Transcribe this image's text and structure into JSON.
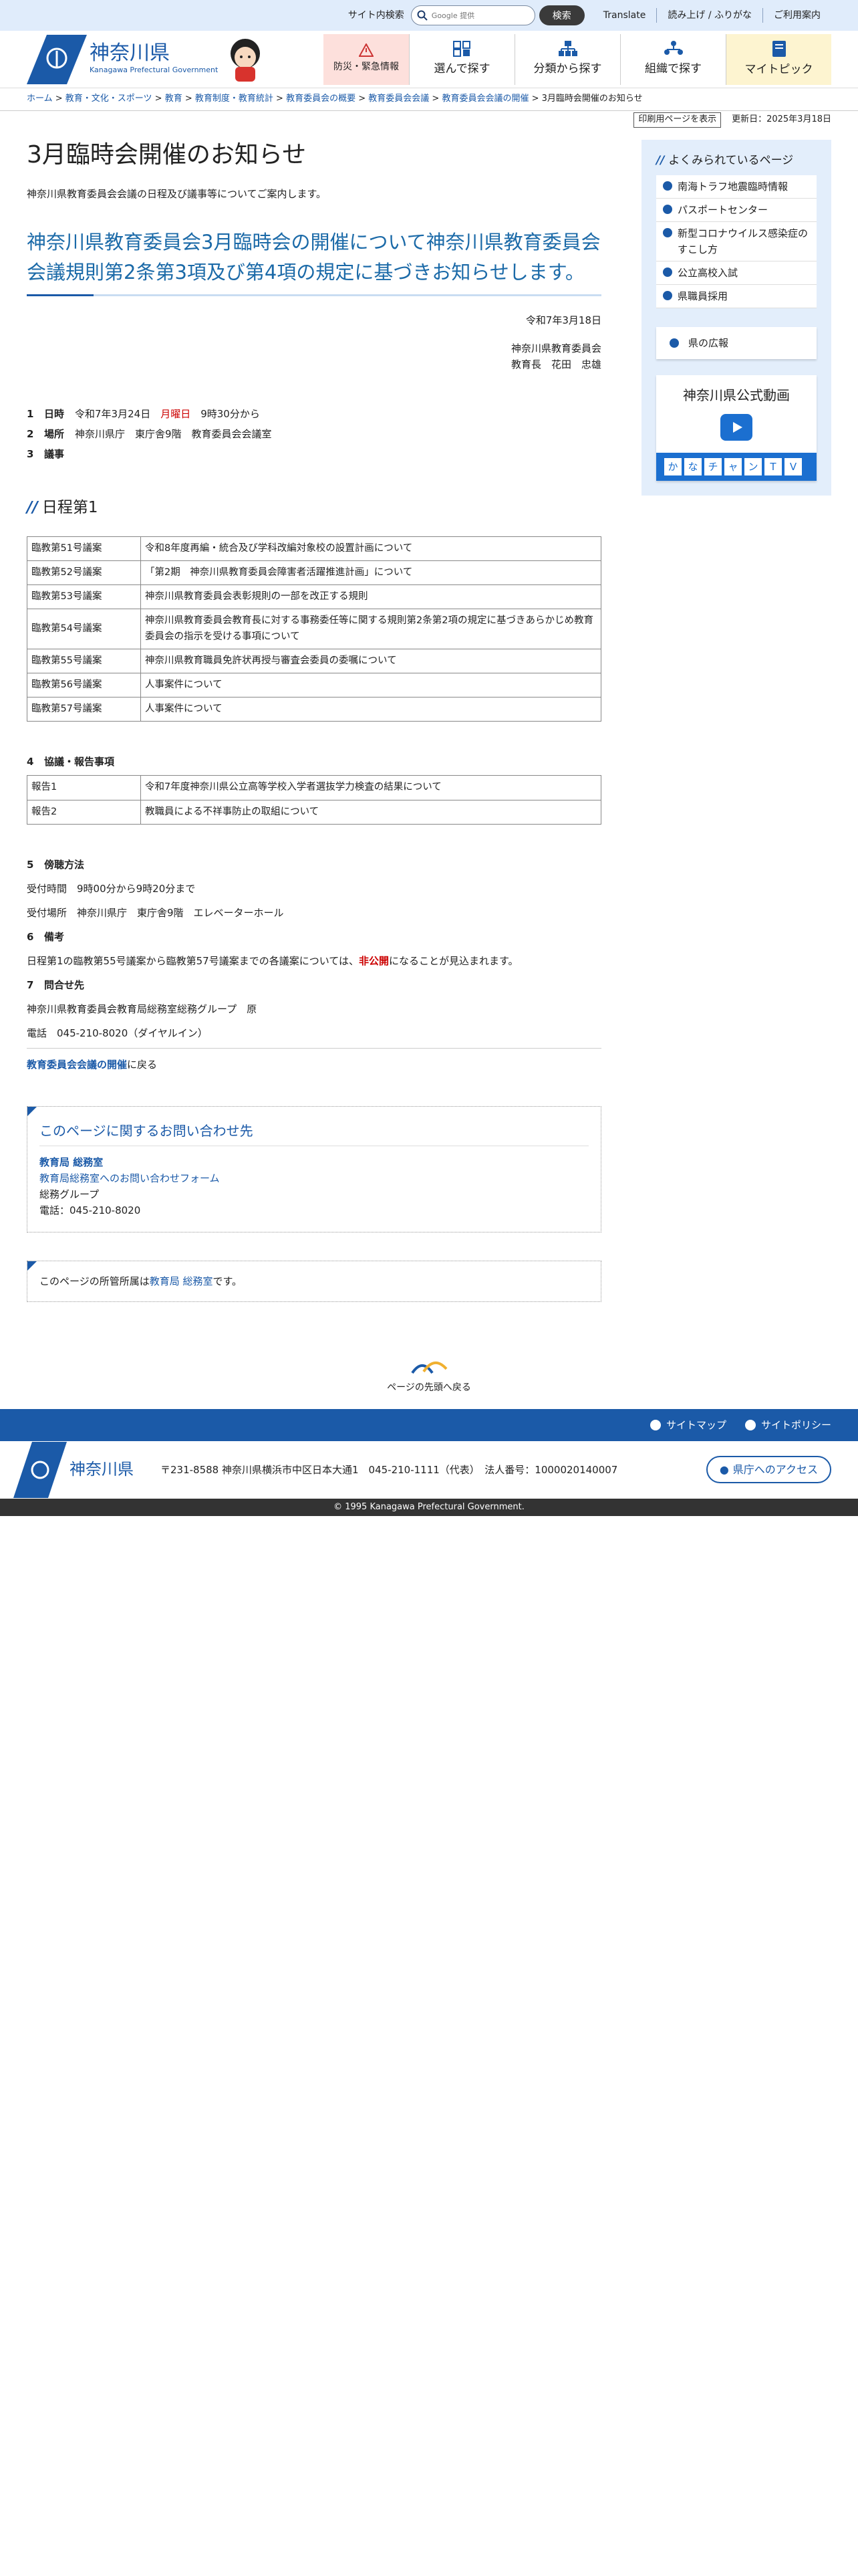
{
  "topbar": {
    "search_label": "サイト内検索",
    "search_placeholder": "Google 提供",
    "search_button": "検索",
    "links": [
      "Translate",
      "読み上げ / ふりがな",
      "ご利用案内"
    ]
  },
  "header": {
    "logo_jp": "神奈川県",
    "logo_en": "Kanagawa Prefectural Government",
    "nav": [
      "防災・緊急情報",
      "選んで探す",
      "分類から探す",
      "組織で探す",
      "マイトピック"
    ]
  },
  "breadcrumb": [
    "ホーム",
    "教育・文化・スポーツ",
    "教育",
    "教育制度・教育統計",
    "教育委員会の概要",
    "教育委員会会議",
    "教育委員会会議の開催",
    "3月臨時会開催のお知らせ"
  ],
  "print_button": "印刷用ページを表示",
  "updated": "更新日：2025年3月18日",
  "main": {
    "title": "3月臨時会開催のお知らせ",
    "intro": "神奈川県教育委員会会議の日程及び議事等についてご案内します。",
    "headline": "神奈川県教育委員会3月臨時会の開催について神奈川県教育委員会会議規則第2条第3項及び第4項の規定に基づきお知らせします。",
    "date": "令和7年3月18日",
    "org": "神奈川県教育委員会",
    "person": "教育長　花田　忠雄",
    "items": [
      {
        "num": "1",
        "label": "日時",
        "pre": "令和7年3月24日　",
        "red": "月曜日",
        "post": "　9時30分から"
      },
      {
        "num": "2",
        "label": "場所",
        "text": "神奈川県庁　東庁舎9階　教育委員会会議室"
      },
      {
        "num": "3",
        "label": "議事",
        "text": ""
      }
    ],
    "schedule_title": "日程第1",
    "agenda": [
      [
        "臨教第51号議案",
        "令和8年度再編・統合及び学科改編対象校の設置計画について"
      ],
      [
        "臨教第52号議案",
        "「第2期　神奈川県教育委員会障害者活躍推進計画」について"
      ],
      [
        "臨教第53号議案",
        "神奈川県教育委員会表彰規則の一部を改正する規則"
      ],
      [
        "臨教第54号議案",
        "神奈川県教育委員会教育長に対する事務委任等に関する規則第2条第2項の規定に基づきあらかじめ教育委員会の指示を受ける事項について"
      ],
      [
        "臨教第55号議案",
        "神奈川県教育職員免許状再授与審査会委員の委嘱について"
      ],
      [
        "臨教第56号議案",
        "人事案件について"
      ],
      [
        "臨教第57号議案",
        "人事案件について"
      ]
    ],
    "s4": {
      "num": "4",
      "label": "協議・報告事項"
    },
    "reports": [
      [
        "報告1",
        "令和7年度神奈川県公立高等学校入学者選抜学力検査の結果について"
      ],
      [
        "報告2",
        "教職員による不祥事防止の取組について"
      ]
    ],
    "s5": {
      "num": "5",
      "label": "傍聴方法",
      "l1": "受付時間　9時00分から9時20分まで",
      "l2": "受付場所　神奈川県庁　東庁舎9階　エレベーターホール"
    },
    "s6": {
      "num": "6",
      "label": "備考",
      "pre": "日程第1の臨教第55号議案から臨教第57号議案までの各議案については、",
      "red": "非公開",
      "post": "になることが見込まれます。"
    },
    "s7": {
      "num": "7",
      "label": "問合せ先",
      "l1": "神奈川県教育委員会教育局総務室総務グループ　原",
      "l2": "電話　045-210-8020（ダイヤルイン）"
    },
    "back_link": "教育委員会会議の開催",
    "back_suffix": "に戻る",
    "contact": {
      "title": "このページに関するお問い合わせ先",
      "dept": "教育局 総務室",
      "form": "教育局総務室へのお問い合わせフォーム",
      "group": "総務グループ",
      "tel": "電話：045-210-8020"
    },
    "owner": {
      "pre": "このページの所管所属は",
      "link": "教育局 総務室",
      "post": "です。"
    },
    "back_top": "ページの先頭へ戻る"
  },
  "side": {
    "faq_title": "よくみられているページ",
    "faq": [
      "南海トラフ地震臨時情報",
      "パスポートセンター",
      "新型コロナウイルス感染症のすこし方",
      "公立高校入試",
      "県職員採用"
    ],
    "koho": "県の広報",
    "video_title": "神奈川県公式動画",
    "tv": [
      "か",
      "な",
      "チ",
      "ャ",
      "ン",
      "T",
      "V"
    ]
  },
  "footer": {
    "links": [
      "サイトマップ",
      "サイトポリシー"
    ],
    "logo": "神奈川県",
    "address": "〒231-8588 神奈川県横浜市中区日本大通1　045-210-1111（代表）　法人番号：1000020140007",
    "access": "県庁へのアクセス",
    "copyright": "© 1995 Kanagawa Prefectural Government."
  }
}
